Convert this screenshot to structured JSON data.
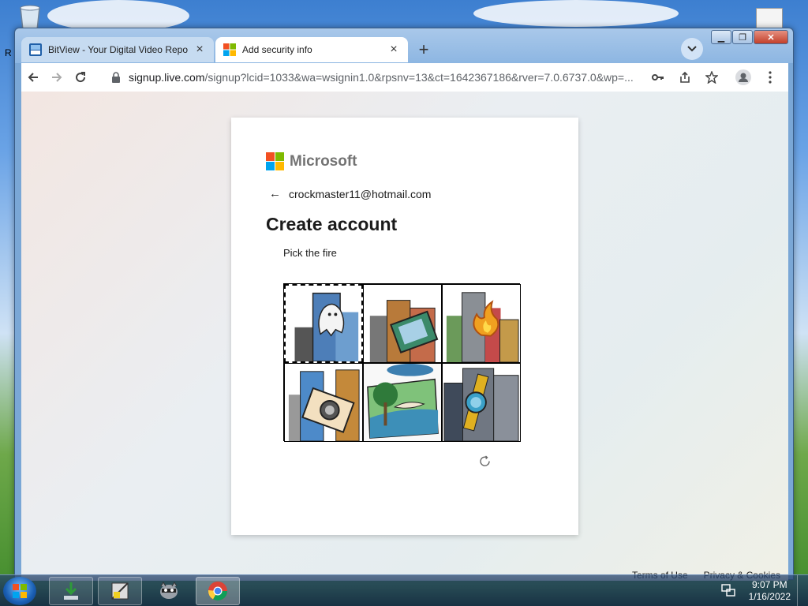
{
  "browser": {
    "tabs": [
      {
        "label": "BitView - Your Digital Video Repo",
        "active": false
      },
      {
        "label": "Add security info",
        "active": true
      }
    ],
    "url_host": "signup.live.com",
    "url_path": "/signup?lcid=1033&wa=wsignin1.0&rpsnv=13&ct=1642367186&rver=7.0.6737.0&wp=..."
  },
  "page": {
    "brand": "Microsoft",
    "identity": "crockmaster11@hotmail.com",
    "title": "Create account",
    "instruction": "Pick the fire",
    "puzzle_tiles": [
      {
        "subject": "ghost",
        "focused": true
      },
      {
        "subject": "photo"
      },
      {
        "subject": "fire"
      },
      {
        "subject": "camera"
      },
      {
        "subject": "bird"
      },
      {
        "subject": "watch"
      }
    ],
    "footer": {
      "terms": "Terms of Use",
      "privacy": "Privacy & Cookies"
    }
  },
  "taskbar": {
    "time": "9:07 PM",
    "date": "1/16/2022"
  },
  "desktop": {
    "label_fragment": "R"
  },
  "colors": {
    "ms_red": "#f25022",
    "ms_green": "#7fba00",
    "ms_blue": "#00a4ef",
    "ms_yellow": "#ffb900"
  }
}
